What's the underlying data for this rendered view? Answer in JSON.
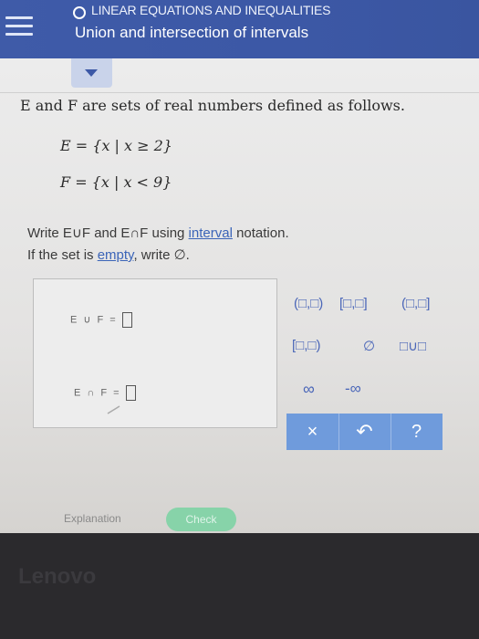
{
  "header": {
    "subtitle": "LINEAR EQUATIONS AND INEQUALITIES",
    "title": "Union and intersection of intervals"
  },
  "problem": {
    "intro": "E and F are sets of real numbers defined as follows.",
    "set_e": "E = {x | x ≥ 2}",
    "set_f": "F = {x | x < 9}",
    "instruction_prefix": "Write E∪F and E∩F using ",
    "instruction_link": "interval",
    "instruction_suffix": " notation.",
    "empty_prefix": "If the set is ",
    "empty_link": "empty",
    "empty_suffix": ", write ∅."
  },
  "answers": {
    "union_label": "E ∪ F =",
    "intersection_label": "E ∩ F ="
  },
  "keypad": {
    "open_open": "(□,□)",
    "closed_closed": "[□,□]",
    "open_closed": "(□,□]",
    "closed_open": "[□,□)",
    "empty_set": "∅",
    "union": "□∪□",
    "infinity": "∞",
    "neg_infinity": "-∞",
    "clear": "×",
    "undo": "↶",
    "help": "?"
  },
  "footer": {
    "explanation": "Explanation",
    "check": "Check"
  },
  "device": {
    "brand": "Lenovo"
  },
  "colors": {
    "header": "#3f5ba8",
    "accent": "#6f9bdc",
    "check": "#87d3a9"
  }
}
